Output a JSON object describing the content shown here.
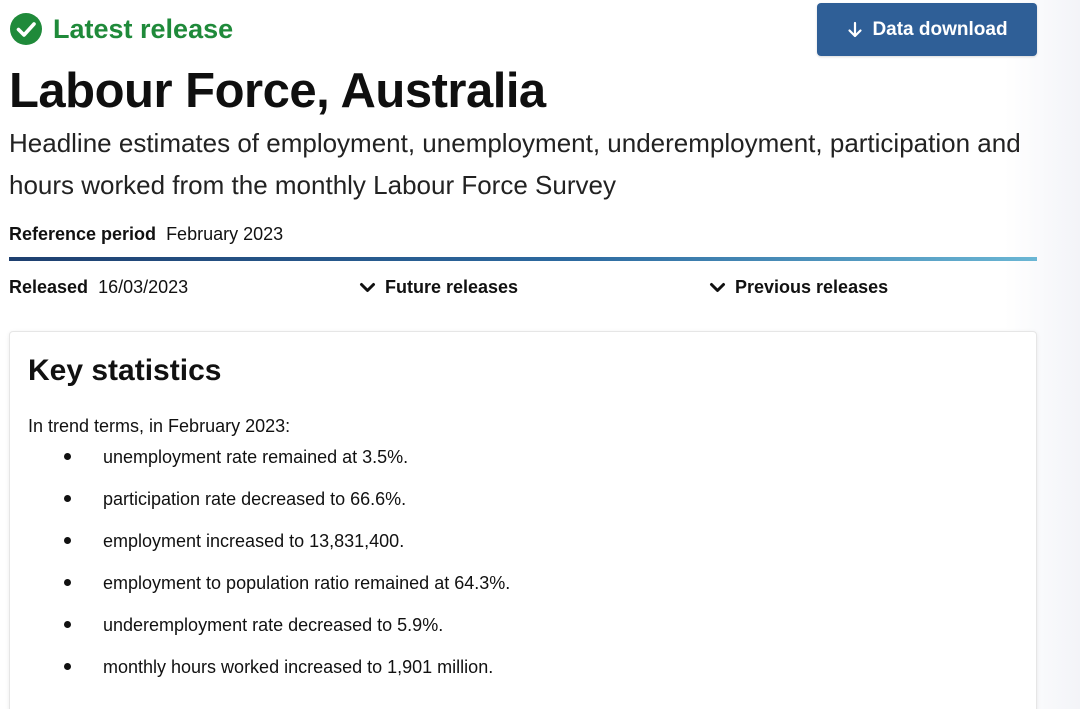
{
  "header": {
    "status_label": "Latest release",
    "status_icon": "check-circle-icon",
    "status_color": "#1f8a3a",
    "download_label": "Data download",
    "download_icon": "arrow-down-icon",
    "download_color": "#2f5f97"
  },
  "title": "Labour Force, Australia",
  "subtitle": "Headline estimates of employment, unemployment, underemployment, participation and hours worked from the monthly Labour Force Survey",
  "reference": {
    "label": "Reference period",
    "value": "February 2023"
  },
  "release": {
    "label": "Released",
    "value": "16/03/2023",
    "future_label": "Future releases",
    "previous_label": "Previous releases",
    "toggle_icon": "chevron-down-icon"
  },
  "key_statistics": {
    "heading": "Key statistics",
    "intro": "In trend terms, in February 2023:",
    "items": [
      "unemployment rate remained at 3.5%.",
      "participation rate decreased to 66.6%.",
      "employment increased to 13,831,400.",
      "employment to population ratio remained at 64.3%.",
      "underemployment rate decreased to 5.9%.",
      "monthly hours worked increased to 1,901 million."
    ]
  }
}
